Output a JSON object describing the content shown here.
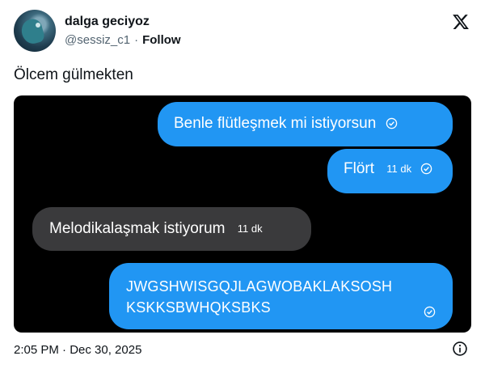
{
  "author": {
    "display_name": "dalga geciyoz",
    "handle": "@sessiz_c1",
    "separator": "·",
    "follow_label": "Follow"
  },
  "tweet": {
    "text": "Ölcem gülmekten",
    "timestamp": "2:05 PM · Dec 30, 2025"
  },
  "chat": {
    "messages": [
      {
        "direction": "outgoing",
        "text": "Benle flütleşmek mi istiyorsun",
        "meta": "",
        "read": true
      },
      {
        "direction": "outgoing",
        "text": "Flört",
        "meta": "11 dk",
        "read": true
      },
      {
        "direction": "incoming",
        "text": "Melodikalaşmak istiyorum",
        "meta": "11 dk",
        "read": false
      },
      {
        "direction": "outgoing",
        "lines": [
          "JWGSHWISGQJLAGWOBAKLAKSOSH",
          "KSKKSBWHQKSBKS"
        ],
        "meta": "",
        "read": true
      }
    ]
  },
  "colors": {
    "outgoing_bubble": "#2196f3",
    "incoming_bubble": "#2c2c2e",
    "chat_background": "#000000"
  },
  "icons": [
    "x-logo-icon",
    "info-icon",
    "read-check-icon"
  ]
}
